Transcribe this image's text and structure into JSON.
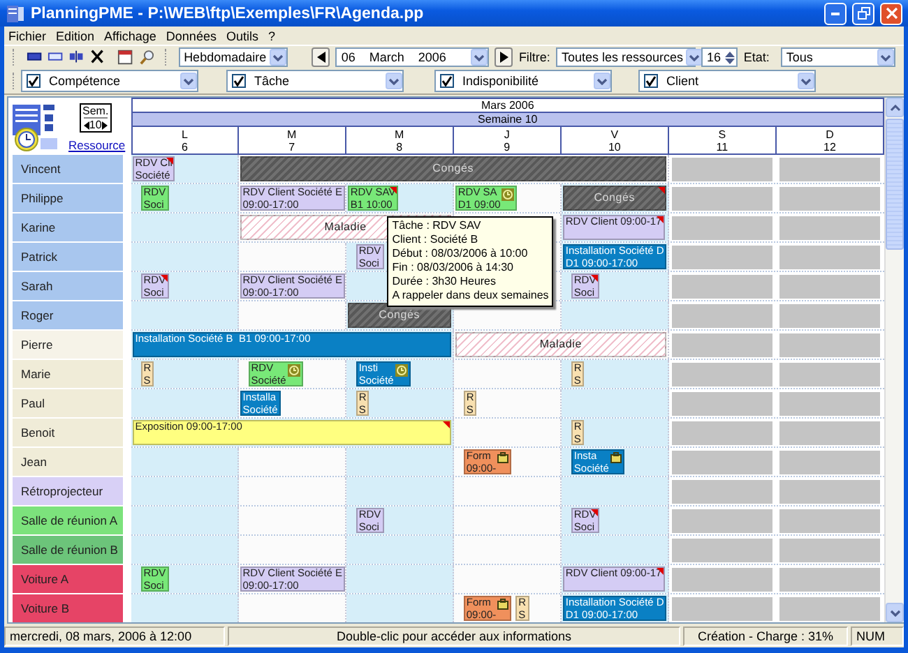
{
  "window": {
    "title": "PlanningPME - P:\\WEB\\ftp\\Exemples\\FR\\Agenda.pp"
  },
  "menu": [
    {
      "label": "Fichier"
    },
    {
      "label": "Edition"
    },
    {
      "label": "Affichage"
    },
    {
      "label": "Données"
    },
    {
      "label": "Outils"
    },
    {
      "label": "?"
    }
  ],
  "toolbar": {
    "view": "Hebdomadaire",
    "date": "06    March    2006",
    "filter_label": "Filtre:",
    "filter": "Toutes les ressources",
    "count": "16",
    "state_label": "Etat:",
    "state": "Tous"
  },
  "filters": [
    {
      "label": "Compétence",
      "checked": true
    },
    {
      "label": "Tâche",
      "checked": true
    },
    {
      "label": "Indisponibilité",
      "checked": true
    },
    {
      "label": "Client",
      "checked": true
    }
  ],
  "corner": {
    "unit": "Sem.",
    "week": "10",
    "link": "Ressource"
  },
  "header": {
    "month": "Mars 2006",
    "week": "Semaine 10",
    "days": [
      {
        "letter": "L",
        "number": "6",
        "shaded": true,
        "weekend": false
      },
      {
        "letter": "M",
        "number": "7",
        "shaded": false,
        "weekend": false
      },
      {
        "letter": "M",
        "number": "8",
        "shaded": true,
        "weekend": false
      },
      {
        "letter": "J",
        "number": "9",
        "shaded": false,
        "weekend": false
      },
      {
        "letter": "V",
        "number": "10",
        "shaded": true,
        "weekend": false
      },
      {
        "letter": "S",
        "number": "11",
        "shaded": false,
        "weekend": true
      },
      {
        "letter": "D",
        "number": "12",
        "shaded": false,
        "weekend": true
      }
    ]
  },
  "resources": [
    {
      "name": "Vincent",
      "color": "#a8c6ee",
      "days": [
        {
          "kind": "busy",
          "events": [
            {
              "kind": "task",
              "color": "#d4ccf4",
              "lines": [
                "RDV Cli",
                "Société"
              ],
              "flag": true
            }
          ]
        },
        {
          "kind": "busy",
          "events": [
            {
              "kind": "absence",
              "color": "#707070",
              "lines": [
                "Congés"
              ],
              "flag": false
            }
          ]
        },
        {
          "kind": "covered"
        },
        {
          "kind": "covered"
        },
        {
          "kind": "covered"
        }
      ]
    },
    {
      "name": "Philippe",
      "color": "#a8c6ee",
      "days": [
        {
          "kind": "busy",
          "events": [
            {
              "kind": "task",
              "color": "#78e878",
              "lines": [
                "RDV",
                "Soci"
              ],
              "flag": false
            }
          ]
        },
        {
          "kind": "busy",
          "events": [
            {
              "kind": "task",
              "color": "#d4ccf4",
              "lines": [
                "RDV Client Société E",
                "09:00-17:00"
              ],
              "flag": false
            }
          ]
        },
        {
          "kind": "busy",
          "events": [
            {
              "kind": "task",
              "color": "#78e878",
              "lines": [
                "RDV SAV",
                "B1 10:00"
              ],
              "flag": true
            }
          ]
        },
        {
          "kind": "busy",
          "events": [
            {
              "kind": "alarm-task",
              "color": "#78e878",
              "lines": [
                "RDV SA",
                "D1 09:00"
              ],
              "flag": false
            }
          ]
        },
        {
          "kind": "busy",
          "events": [
            {
              "kind": "absence",
              "color": "#707070",
              "lines": [
                "Congés"
              ],
              "flag": true
            }
          ]
        }
      ]
    },
    {
      "name": "Karine",
      "color": "#a8c6ee",
      "days": [
        {
          "kind": "free"
        },
        {
          "kind": "busy",
          "events": [
            {
              "kind": "absence",
              "color": "#f0c0cc",
              "lines": [
                "Maladie"
              ]
            }
          ]
        },
        {
          "kind": "covered"
        },
        {
          "kind": "free"
        },
        {
          "kind": "busy",
          "events": [
            {
              "kind": "task",
              "color": "#d4ccf4",
              "lines": [
                "RDV Client 09:00-17"
              ],
              "flag": true
            }
          ]
        }
      ]
    },
    {
      "name": "Patrick",
      "color": "#a8c6ee",
      "days": [
        {
          "kind": "free"
        },
        {
          "kind": "free"
        },
        {
          "kind": "busy",
          "events": [
            {
              "kind": "task",
              "color": "#d4ccf4",
              "lines": [
                "RDV",
                "Soci"
              ],
              "flag": false
            }
          ]
        },
        {
          "kind": "free"
        },
        {
          "kind": "busy",
          "events": [
            {
              "kind": "task",
              "color": "#0a80c4",
              "lines": [
                "Installation Société D",
                "D1 09:00-17:00"
              ],
              "flag": false
            }
          ]
        }
      ]
    },
    {
      "name": "Sarah",
      "color": "#a8c6ee",
      "days": [
        {
          "kind": "busy",
          "events": [
            {
              "kind": "task",
              "color": "#d4ccf4",
              "lines": [
                "RDV",
                "Soci"
              ],
              "flag": true
            }
          ]
        },
        {
          "kind": "busy",
          "events": [
            {
              "kind": "task",
              "color": "#d4ccf4",
              "lines": [
                "RDV Client Société E",
                "09:00-17:00"
              ],
              "flag": false
            }
          ]
        },
        {
          "kind": "free"
        },
        {
          "kind": "free"
        },
        {
          "kind": "busy",
          "events": [
            {
              "kind": "task",
              "color": "#d4ccf4",
              "lines": [
                "RDV",
                "Soci"
              ],
              "flag": true
            }
          ]
        }
      ]
    },
    {
      "name": "Roger",
      "color": "#a8c6ee",
      "days": [
        {
          "kind": "free"
        },
        {
          "kind": "free"
        },
        {
          "kind": "busy",
          "events": [
            {
              "kind": "absence",
              "color": "#707070",
              "lines": [
                "Congés"
              ],
              "flag": false
            }
          ]
        },
        {
          "kind": "free"
        },
        {
          "kind": "free"
        }
      ]
    },
    {
      "name": "Pierre",
      "color": "#f6f3e8",
      "days": [
        {
          "kind": "busy",
          "events": [
            {
              "kind": "task",
              "color": "#0a80c4",
              "lines": [
                "Installation Société B  B1 09:00-17:00"
              ],
              "flag": false
            }
          ]
        },
        {
          "kind": "covered"
        },
        {
          "kind": "covered"
        },
        {
          "kind": "busy",
          "events": [
            {
              "kind": "absence",
              "color": "#f0c0cc",
              "lines": [
                "Maladie"
              ],
              "flag": false
            }
          ]
        },
        {
          "kind": "covered"
        }
      ]
    },
    {
      "name": "Marie",
      "color": "#f0ecd8",
      "days": [
        {
          "kind": "busy",
          "events": [
            {
              "kind": "task",
              "color": "#f8e0b0",
              "lines": [
                "R",
                "S"
              ],
              "flag": false
            }
          ]
        },
        {
          "kind": "busy",
          "events": [
            {
              "kind": "alarm-task",
              "color": "#78e878",
              "lines": [
                "RDV",
                "Société"
              ],
              "flag": false
            }
          ]
        },
        {
          "kind": "busy",
          "events": [
            {
              "kind": "alarm-task",
              "color": "#0a80c4",
              "lines": [
                "Insti",
                "Société"
              ],
              "flag": false
            }
          ]
        },
        {
          "kind": "free"
        },
        {
          "kind": "busy",
          "events": [
            {
              "kind": "task",
              "color": "#f8e0b0",
              "lines": [
                "R",
                "S"
              ],
              "flag": false
            }
          ]
        }
      ]
    },
    {
      "name": "Paul",
      "color": "#f0ecd8",
      "days": [
        {
          "kind": "free"
        },
        {
          "kind": "busy",
          "events": [
            {
              "kind": "task",
              "color": "#0a80c4",
              "lines": [
                "Installa",
                "Société"
              ],
              "flag": false
            }
          ]
        },
        {
          "kind": "busy",
          "events": [
            {
              "kind": "task",
              "color": "#f8e0b0",
              "lines": [
                "R",
                "S"
              ],
              "flag": false
            }
          ]
        },
        {
          "kind": "busy",
          "events": [
            {
              "kind": "task",
              "color": "#f8e0b0",
              "lines": [
                "R",
                "S"
              ],
              "flag": false
            }
          ]
        },
        {
          "kind": "free"
        }
      ]
    },
    {
      "name": "Benoit",
      "color": "#f0ecd8",
      "days": [
        {
          "kind": "busy",
          "events": [
            {
              "kind": "task",
              "color": "#ffff80",
              "lines": [
                "Exposition 09:00-17:00"
              ],
              "flag": true
            }
          ]
        },
        {
          "kind": "covered"
        },
        {
          "kind": "covered"
        },
        {
          "kind": "free"
        },
        {
          "kind": "busy",
          "events": [
            {
              "kind": "task",
              "color": "#f8e0b0",
              "lines": [
                "R",
                "S"
              ],
              "flag": false
            }
          ]
        }
      ]
    },
    {
      "name": "Jean",
      "color": "#f0ecd8",
      "days": [
        {
          "kind": "free"
        },
        {
          "kind": "free"
        },
        {
          "kind": "free"
        },
        {
          "kind": "busy",
          "events": [
            {
              "kind": "linked-task",
              "color": "#f0905c",
              "lines": [
                "Form",
                "09:00-"
              ],
              "flag": false
            }
          ]
        },
        {
          "kind": "busy",
          "events": [
            {
              "kind": "linked-task",
              "color": "#0a80c4",
              "lines": [
                "Insta",
                "Société"
              ],
              "flag": false
            }
          ]
        }
      ]
    },
    {
      "name": "Rétroprojecteur",
      "color": "#d8d0f6",
      "days": [
        {
          "kind": "free"
        },
        {
          "kind": "free"
        },
        {
          "kind": "free"
        },
        {
          "kind": "free"
        },
        {
          "kind": "free"
        }
      ]
    },
    {
      "name": "Salle de réunion A",
      "color": "#7ce27c",
      "days": [
        {
          "kind": "free"
        },
        {
          "kind": "free"
        },
        {
          "kind": "busy",
          "events": [
            {
              "kind": "task",
              "color": "#d4ccf4",
              "lines": [
                "RDV",
                "Soci"
              ],
              "flag": false
            }
          ]
        },
        {
          "kind": "free"
        },
        {
          "kind": "busy",
          "events": [
            {
              "kind": "task",
              "color": "#d4ccf4",
              "lines": [
                "RDV",
                "Soci"
              ],
              "flag": true
            }
          ]
        }
      ]
    },
    {
      "name": "Salle de réunion B",
      "color": "#6cc47a",
      "days": [
        {
          "kind": "free"
        },
        {
          "kind": "free"
        },
        {
          "kind": "free"
        },
        {
          "kind": "free"
        },
        {
          "kind": "free"
        }
      ]
    },
    {
      "name": "Voiture A",
      "color": "#e64466",
      "days": [
        {
          "kind": "busy",
          "events": [
            {
              "kind": "task",
              "color": "#78e878",
              "lines": [
                "RDV",
                "Soci"
              ],
              "flag": false
            }
          ]
        },
        {
          "kind": "busy",
          "events": [
            {
              "kind": "task",
              "color": "#d4ccf4",
              "lines": [
                "RDV Client Société E",
                "09:00-17:00"
              ],
              "flag": false
            }
          ]
        },
        {
          "kind": "free"
        },
        {
          "kind": "free"
        },
        {
          "kind": "busy",
          "events": [
            {
              "kind": "task",
              "color": "#d4ccf4",
              "lines": [
                "RDV Client 09:00-17"
              ],
              "flag": true
            }
          ]
        }
      ]
    },
    {
      "name": "Voiture B",
      "color": "#e64466",
      "days": [
        {
          "kind": "free"
        },
        {
          "kind": "free"
        },
        {
          "kind": "free"
        },
        {
          "kind": "busy",
          "events": [
            {
              "kind": "linked-task",
              "color": "#f0905c",
              "lines": [
                "Form",
                "09:00-"
              ],
              "flag": false
            },
            {
              "kind": "task",
              "color": "#f8e0b0",
              "lines": [
                "R",
                "S"
              ],
              "flag": false
            }
          ]
        },
        {
          "kind": "busy",
          "events": [
            {
              "kind": "task",
              "color": "#0a80c4",
              "lines": [
                "Installation Société D",
                "D1 09:00-17:00"
              ],
              "flag": false
            }
          ]
        }
      ]
    }
  ],
  "tooltip": {
    "lines": [
      "Tâche : RDV SAV",
      "Client : Société B",
      "Début : 08/03/2006 à 10:00",
      "Fin : 08/03/2006 à 14:30",
      "Durée : 3h30 Heures",
      "A rappeler dans deux semaines"
    ]
  },
  "status_bar": {
    "date": "mercredi, 08 mars, 2006 à 12:00",
    "hint": "Double-clic pour accéder aux informations",
    "mode": "Création - Charge : 31%",
    "num": "NUM"
  }
}
